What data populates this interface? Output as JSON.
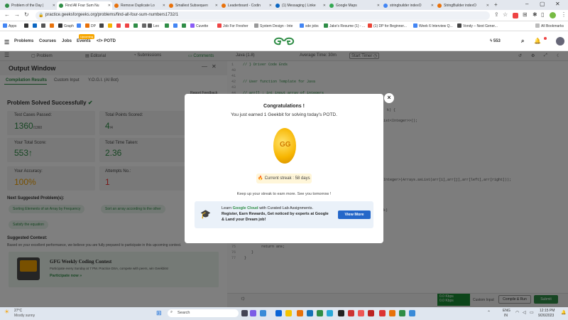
{
  "browser": {
    "tabs": [
      {
        "label": "Problem of the Day |",
        "color": "#2f8d46"
      },
      {
        "label": "Find All Four Sum Nu",
        "color": "#2f8d46"
      },
      {
        "label": "Remove Duplicate Lo",
        "color": "#e8710a"
      },
      {
        "label": "Smallest Subsequen",
        "color": "#e8710a"
      },
      {
        "label": "Leaderboard - Codin",
        "color": "#e8710a"
      },
      {
        "label": "(1) Messaging | Linke",
        "color": "#0a66c2"
      },
      {
        "label": "Google Maps",
        "color": "#34a853"
      },
      {
        "label": "stringbuilder indexO",
        "color": "#4285f4"
      },
      {
        "label": "StringBuilder indexO",
        "color": "#e8710a"
      }
    ],
    "url": "practice.geeksforgeeks.org/problems/find-all-four-sum-numbers1732/1",
    "bookmarks": [
      "Apps",
      "Graph",
      "DP",
      "Lex",
      "Cuvette",
      "Job For Fresher",
      "System Design - Inte",
      "sde jobs",
      "Jake's Resume (1) - ...",
      "(1) DP for Beginner...",
      "Week 6 Interview Q...",
      "Vondy – Next Gener...",
      "All Bookmarks"
    ]
  },
  "gfg": {
    "nav": [
      "Problems",
      "Courses",
      "Jobs",
      "Events",
      "POTD"
    ],
    "upcoming": "Upcoming",
    "streak_count": "553",
    "toolbar_tabs": [
      "Problem",
      "Editorial",
      "Submissions",
      "Comments"
    ],
    "lang": "Java (1.8)",
    "avg_time": "Average Time: 30m",
    "start_timer": "Start Timer"
  },
  "output": {
    "title": "Output Window",
    "tabs": [
      "Compilation Results",
      "Custom Input",
      "Y.O.G.I. (AI Bot)"
    ],
    "report": "Report Feedback",
    "status": "Problem Solved Successfully",
    "test_cases_label": "Test Cases Passed:",
    "test_cases": "1360",
    "test_cases_total": "/1360",
    "points_label": "Total Points Scored:",
    "points": "4",
    "points_total": "/4",
    "score_label": "Your Total Score:",
    "score": "553",
    "time_label": "Total Time Taken:",
    "time": "2.36",
    "accuracy_label": "Your Accuracy:",
    "accuracy": "100%",
    "attempts_label": "Attempts No.:",
    "attempts": "1",
    "suggested_label": "Next Suggested Problem(s):",
    "suggested": [
      "Sorting Elements of an Array by Frequency",
      "Sort an array according to the other",
      "Satisfy the equation"
    ],
    "contest_label": "Suggested Contest:",
    "contest_desc": "Based on your excellent performance, we believe you are fully prepared to participate in this upcoming contest.",
    "contest_title": "GFG Weekly Coding Contest",
    "contest_sub": "Participate every Sunday at 7 PM. Practice DSA, compete with peers, win Geekbits!",
    "contest_link": "Participate now »"
  },
  "code": {
    "lines": [
      "1",
      "40",
      "41",
      "42",
      "43",
      "44",
      "45",
      "75",
      "76",
      "77"
    ],
    "l1": "// } Driver Code Ends",
    "l42": "// User function Template for Java",
    "l44": "// arr[] : int input array of integers",
    "s1": "k) {",
    "s2": "ist<Integer>>();",
    "s3": "Integer>(Arrays.asList(arr[i],arr[j],arr[left],arr[right]));",
    "s4": "k)",
    "ret": "return ans;",
    "b1": "}",
    "b2": "}"
  },
  "modal": {
    "title": "Congratulations !",
    "subtitle": "You just earned 1 Geekbit for solving today's POTD.",
    "coin_text": "GG",
    "streak": "Current streak : 58 days",
    "keepup": "Keep up your streak to earn more. See you tomorrow !",
    "ad_line1a": "Learn ",
    "ad_line1b": "Google Cloud",
    "ad_line1c": " with Curated Lab Assignments.",
    "ad_line2": "Register, Earn Rewards, Get noticed by experts at Google",
    "ad_line3": "& Land your Dream job!",
    "view_more": "View More",
    "close": "×"
  },
  "bottom": {
    "net1": "0.0 Kbps",
    "net2": "0.0 Kbps",
    "custom": "Custom Input",
    "compile": "Compile & Run",
    "submit": "Submit"
  },
  "taskbar": {
    "temp": "27°C",
    "weather": "Mostly sunny",
    "search": "Search",
    "lang": "ENG",
    "region": "IN",
    "time": "12:15 PM",
    "date": "9/26/2023"
  },
  "colors": {
    "brand": "#2f8d46",
    "overlay": "rgba(0,0,0,0.5)",
    "view_more": "#2467c9"
  }
}
